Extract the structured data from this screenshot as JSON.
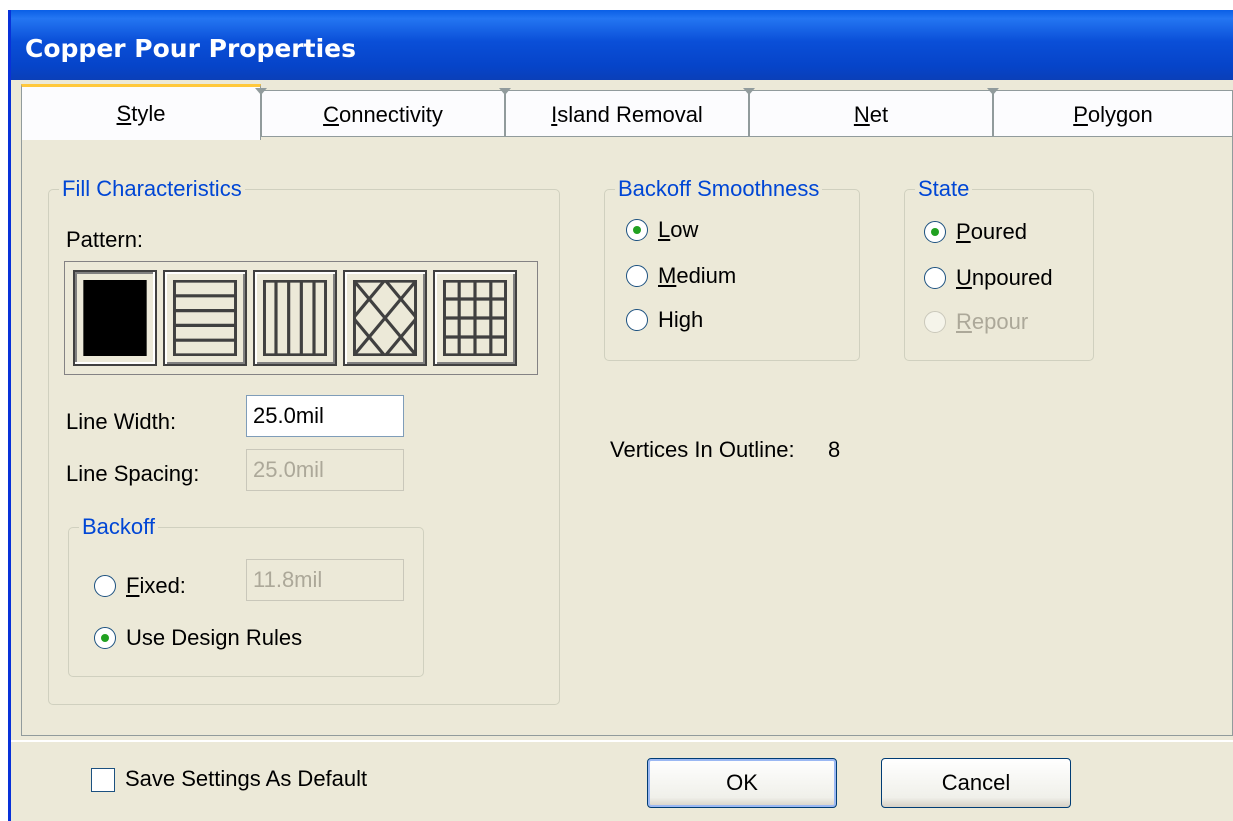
{
  "window": {
    "title": "Copper Pour Properties"
  },
  "tabs": [
    {
      "label": "Style",
      "selected": true
    },
    {
      "label": "Connectivity",
      "selected": false
    },
    {
      "label": "Island Removal",
      "selected": false
    },
    {
      "label": "Net",
      "selected": false
    },
    {
      "label": "Polygon",
      "selected": false
    }
  ],
  "fill": {
    "title": "Fill Characteristics",
    "pattern_label": "Pattern:",
    "patterns": [
      "solid-fill-icon",
      "horizontal-lines-icon",
      "vertical-lines-icon",
      "diagonal-crosshatch-icon",
      "orthogonal-crosshatch-icon"
    ],
    "selected_pattern": "solid-fill-icon",
    "line_width_label": "Line Width:",
    "line_width_value": "25.0mil",
    "line_spacing_label": "Line Spacing:",
    "line_spacing_value": "25.0mil"
  },
  "backoff": {
    "title": "Backoff",
    "fixed_label": "Fixed:",
    "fixed_value": "11.8mil",
    "design_rules_label": "Use Design Rules",
    "selected": "Use Design Rules"
  },
  "smoothness": {
    "title": "Backoff Smoothness",
    "options": [
      "Low",
      "Medium",
      "High"
    ],
    "selected": "Low"
  },
  "state": {
    "title": "State",
    "options": [
      "Poured",
      "Unpoured",
      "Repour"
    ],
    "selected": "Poured",
    "disabled": [
      "Repour"
    ]
  },
  "vertices": {
    "label": "Vertices In Outline:",
    "value": "8"
  },
  "footer": {
    "save_default_label": "Save Settings As Default",
    "save_default_checked": false,
    "ok_label": "OK",
    "cancel_label": "Cancel"
  },
  "colors": {
    "titlebar": "#0a4fd8",
    "group_title": "#0046d5",
    "dialog_bg": "#ece9d8",
    "tab_accent": "#ffc83c"
  }
}
